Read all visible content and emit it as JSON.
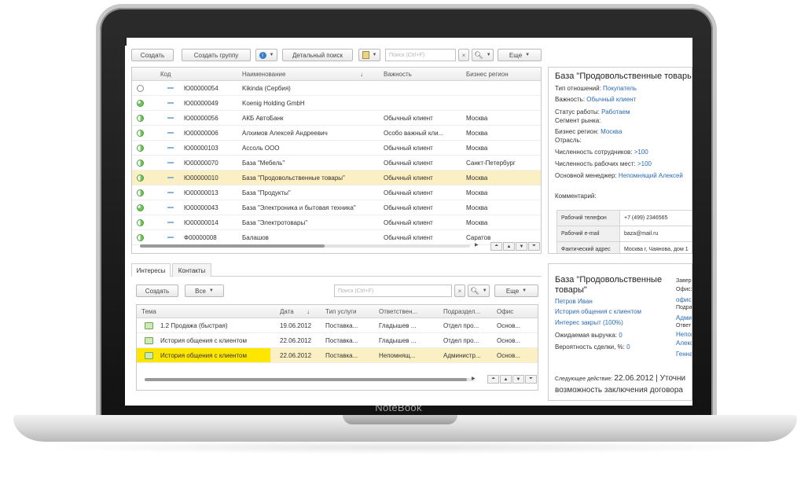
{
  "device": {
    "brand": "NoteBook"
  },
  "toolbar": {
    "create": "Создать",
    "create_group": "Создать группу",
    "detailed_search": "Детальный поиск",
    "search_placeholder": "Поиск (Ctrl+F)",
    "more": "Еще"
  },
  "main_grid": {
    "columns": {
      "code": "Код",
      "name": "Наименование",
      "importance": "Важность",
      "region": "Бизнес регион"
    },
    "rows": [
      {
        "code": "Ю00000054",
        "name": "Kikinda (Сербия)",
        "importance": "",
        "region": "",
        "status": "empty"
      },
      {
        "code": "Ю00000049",
        "name": "Koenig Holding GmbH",
        "importance": "",
        "region": "",
        "status": "partial"
      },
      {
        "code": "Ю00000056",
        "name": "АКБ АвтоБанк",
        "importance": "Обычный клиент",
        "region": "Москва",
        "status": "half"
      },
      {
        "code": "Ю00000006",
        "name": "Алхимов Алексей Андреевич",
        "importance": "Особо важный кли...",
        "region": "Москва",
        "status": "half"
      },
      {
        "code": "Ю00000103",
        "name": "Ассоль ООО",
        "importance": "Обычный клиент",
        "region": "Москва",
        "status": "half"
      },
      {
        "code": "Ю00000070",
        "name": "База \"Мебель\"",
        "importance": "Обычный клиент",
        "region": "Санкт-Петербург",
        "status": "half"
      },
      {
        "code": "Ю00000010",
        "name": "База \"Продовольственные товары\"",
        "importance": "Обычный клиент",
        "region": "Москва",
        "status": "half"
      },
      {
        "code": "Ю00000013",
        "name": "База \"Продукты\"",
        "importance": "Обычный клиент",
        "region": "Москва",
        "status": "half"
      },
      {
        "code": "Ю00000043",
        "name": "База \"Электроника и бытовая техника\"",
        "importance": "Обычный клиент",
        "region": "Москва",
        "status": "partial"
      },
      {
        "code": "Ю00000014",
        "name": "База \"Электротовары\"",
        "importance": "Обычный клиент",
        "region": "Москва",
        "status": "half"
      },
      {
        "code": "Ф00000008",
        "name": "Балашов",
        "importance": "Обычный клиент",
        "region": "Саратов",
        "status": "half"
      }
    ],
    "selected_index": 6
  },
  "details": {
    "title": "База \"Продовольственные товары\"",
    "relation_label": "Тип отношений:",
    "relation_value": "Покупатель",
    "importance_label": "Важность:",
    "importance_value": "Обычный клиент",
    "work_status_label": "Статус работы:",
    "work_status_value": "Работаем",
    "segment_label": "Сегмент рынка:",
    "region_label": "Бизнес регион:",
    "region_value": "Москва",
    "industry_label": "Отрасль:",
    "employees_label": "Численность сотрудников:",
    "employees_value": ">100",
    "workplaces_label": "Численность рабочих мест:",
    "workplaces_value": ">100",
    "manager_label": "Основной менеджер:",
    "manager_value": "Непомнящий Алексей",
    "comment_label": "Комментарий:",
    "contacts": [
      {
        "label": "Рабочий телефон",
        "value": "+7 (499) 2346565"
      },
      {
        "label": "Рабочий e-mail",
        "value": "baza@mail.ru"
      },
      {
        "label": "Фактический адрес",
        "value": "Москва г, Чаянова, дом 1"
      }
    ]
  },
  "bottom": {
    "tabs": [
      "Интересы",
      "Контакты"
    ],
    "create": "Создать",
    "filter": "Все",
    "search_placeholder": "Поиск (Ctrl+F)",
    "more": "Еще",
    "columns": {
      "topic": "Тема",
      "date": "Дата",
      "service": "Тип услуги",
      "responsible": "Ответствен...",
      "department": "Подраздел...",
      "office": "Офис"
    },
    "rows": [
      {
        "topic": "1.2 Продажа (быстрая)",
        "date": "19.06.2012",
        "service": "Поставка...",
        "responsible": "Гладышев ...",
        "department": "Отдел про...",
        "office": "Основ..."
      },
      {
        "topic": "История общения с клиентом",
        "date": "22.06.2012",
        "service": "Поставка...",
        "responsible": "Гладышев ...",
        "department": "Отдел про...",
        "office": "Основ..."
      },
      {
        "topic": "История общения с клиентом",
        "date": "22.06.2012",
        "service": "Поставка...",
        "responsible": "Непомнящ...",
        "department": "Администр...",
        "office": "Основ..."
      }
    ],
    "selected_index": 2
  },
  "interest_panel": {
    "title_line1": "База \"Продовольственные",
    "title_line2": "товары\"",
    "person": "Петров Иван",
    "history": "История общения с клиентом",
    "status": "Интерес закрыт (100%)",
    "revenue_label": "Ожидаемая выручка:",
    "revenue_value": "0",
    "probability_label": "Вероятность сделки, %:",
    "probability_value": "0",
    "right_col": [
      "Завер",
      "Офис:",
      "офис",
      "Подра",
      "Адми",
      "Ответ",
      "Непом",
      "Алекс",
      "Генна"
    ],
    "next_action_label": "Следующее действие:",
    "next_action_value": "22.06.2012 | Уточни",
    "next_action_line2": "возможность заключения договора"
  }
}
